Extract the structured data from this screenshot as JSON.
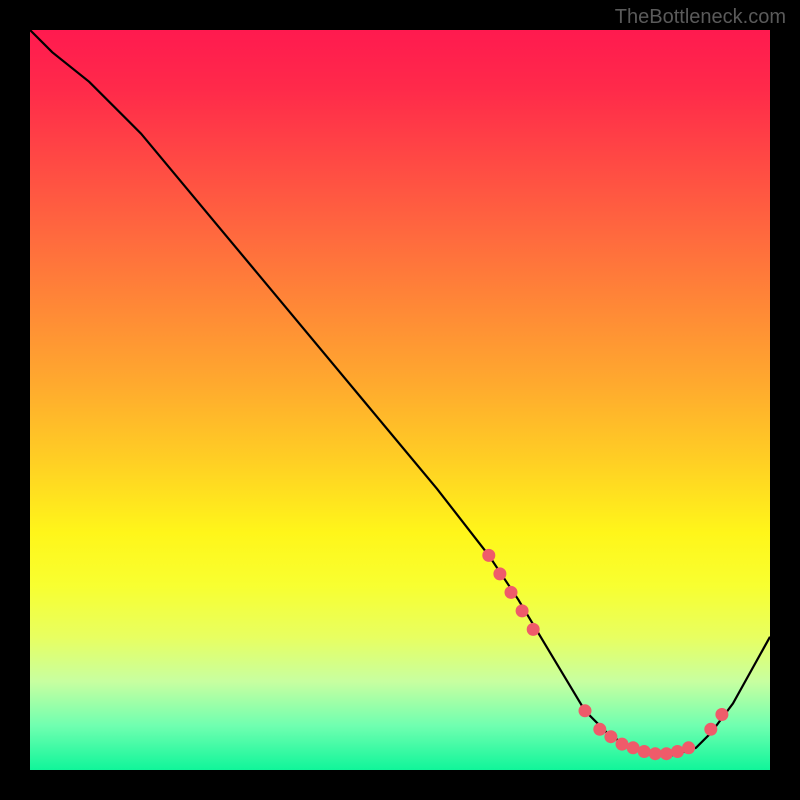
{
  "watermark": "TheBottleneck.com",
  "chart_data": {
    "type": "line",
    "title": "",
    "xlabel": "",
    "ylabel": "",
    "xlim": [
      0,
      100
    ],
    "ylim": [
      0,
      100
    ],
    "series": [
      {
        "name": "curve",
        "x": [
          0,
          3,
          8,
          15,
          25,
          35,
          45,
          55,
          62,
          66,
          69,
          72,
          75,
          78,
          81,
          84,
          87,
          90,
          92,
          95,
          100
        ],
        "y": [
          100,
          97,
          93,
          86,
          74,
          62,
          50,
          38,
          29,
          23,
          18,
          13,
          8,
          5,
          3,
          2,
          2,
          3,
          5,
          9,
          18
        ]
      }
    ],
    "markers": [
      {
        "x": 62.0,
        "y": 29.0
      },
      {
        "x": 63.5,
        "y": 26.5
      },
      {
        "x": 65.0,
        "y": 24.0
      },
      {
        "x": 66.5,
        "y": 21.5
      },
      {
        "x": 68.0,
        "y": 19.0
      },
      {
        "x": 75.0,
        "y": 8.0
      },
      {
        "x": 77.0,
        "y": 5.5
      },
      {
        "x": 78.5,
        "y": 4.5
      },
      {
        "x": 80.0,
        "y": 3.5
      },
      {
        "x": 81.5,
        "y": 3.0
      },
      {
        "x": 83.0,
        "y": 2.5
      },
      {
        "x": 84.5,
        "y": 2.2
      },
      {
        "x": 86.0,
        "y": 2.2
      },
      {
        "x": 87.5,
        "y": 2.5
      },
      {
        "x": 89.0,
        "y": 3.0
      },
      {
        "x": 92.0,
        "y": 5.5
      },
      {
        "x": 93.5,
        "y": 7.5
      }
    ]
  }
}
